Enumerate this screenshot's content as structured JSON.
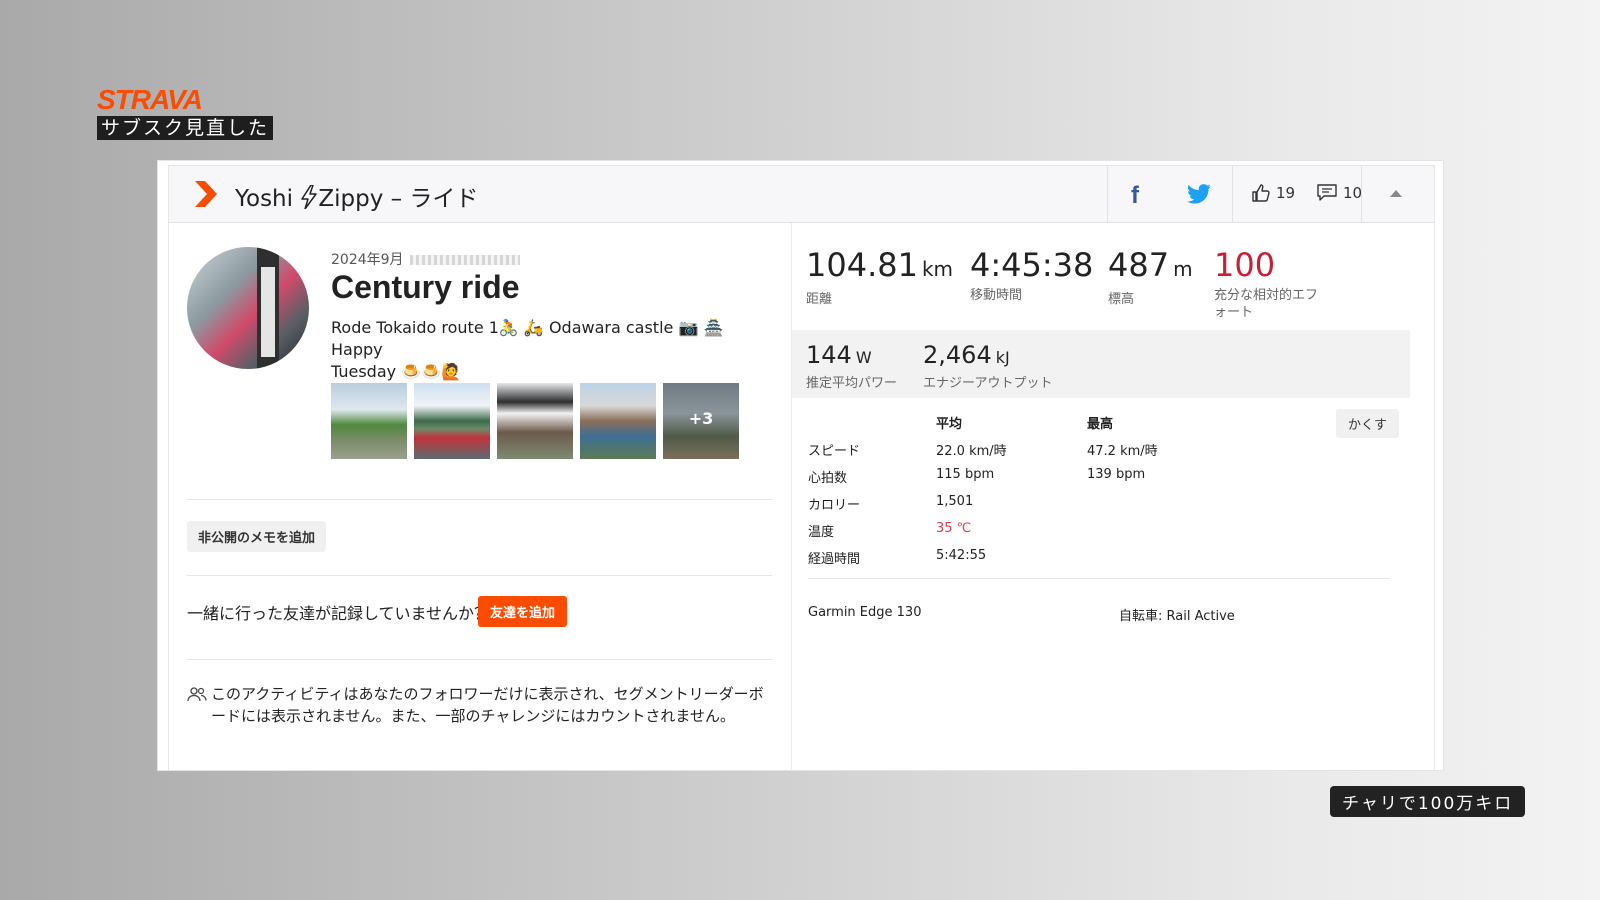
{
  "overlay": {
    "brand": "STRAVA",
    "brand_subtitle": "サブスク見直した",
    "corner_badge": "チャリで100万キロ"
  },
  "header": {
    "title_before": "Yoshi",
    "title_after": "Zippy – ライド",
    "kudos_count": "19",
    "comment_count": "10"
  },
  "activity": {
    "date": "2024年9月",
    "title": "Century ride",
    "description_line1": "Rode Tokaido route 1🚴 🛵 Odawara castle 📷 🏯 Happy",
    "description_line2": "Tuesday 🍮🍮🙋",
    "more_photos": "+3"
  },
  "actions": {
    "private_note": "非公開のメモを追加",
    "friends_question": "一緒に行った友達が記録していませんか？",
    "add_friends": "友達を追加",
    "visibility_notice": "このアクティビティはあなたのフォロワーだけに表示され、セグメントリーダーボードには表示されません。また、一部のチャレンジにはカウントされません。"
  },
  "stats": {
    "distance": {
      "value": "104.81",
      "unit": "km",
      "label": "距離"
    },
    "moving_time": {
      "value": "4:45:38",
      "label": "移動時間"
    },
    "elevation": {
      "value": "487",
      "unit": "m",
      "label": "標高"
    },
    "relative_effort": {
      "value": "100",
      "label": "充分な相対的エフォート"
    },
    "power": {
      "value": "144",
      "unit": "W",
      "label": "推定平均パワー"
    },
    "energy": {
      "value": "2,464",
      "unit": "kJ",
      "label": "エナジーアウトプット"
    }
  },
  "details": {
    "col_avg": "平均",
    "col_max": "最高",
    "hide_label": "かくす",
    "rows": [
      {
        "label": "スピード",
        "avg": "22.0 km/時",
        "max": "47.2 km/時"
      },
      {
        "label": "心拍数",
        "avg": "115 bpm",
        "max": "139 bpm"
      },
      {
        "label": "カロリー",
        "avg": "1,501",
        "max": ""
      },
      {
        "label": "温度",
        "avg": "35 ℃",
        "max": ""
      },
      {
        "label": "経過時間",
        "avg": "5:42:55",
        "max": ""
      }
    ],
    "device": "Garmin Edge 130",
    "bike": "自転車: Rail Active"
  },
  "colors": {
    "strava_orange": "#fc4c02",
    "effort_red": "#c81f35",
    "temp_red": "#e03b4b",
    "facebook_blue": "#3b5998",
    "twitter_blue": "#1da1f2"
  }
}
